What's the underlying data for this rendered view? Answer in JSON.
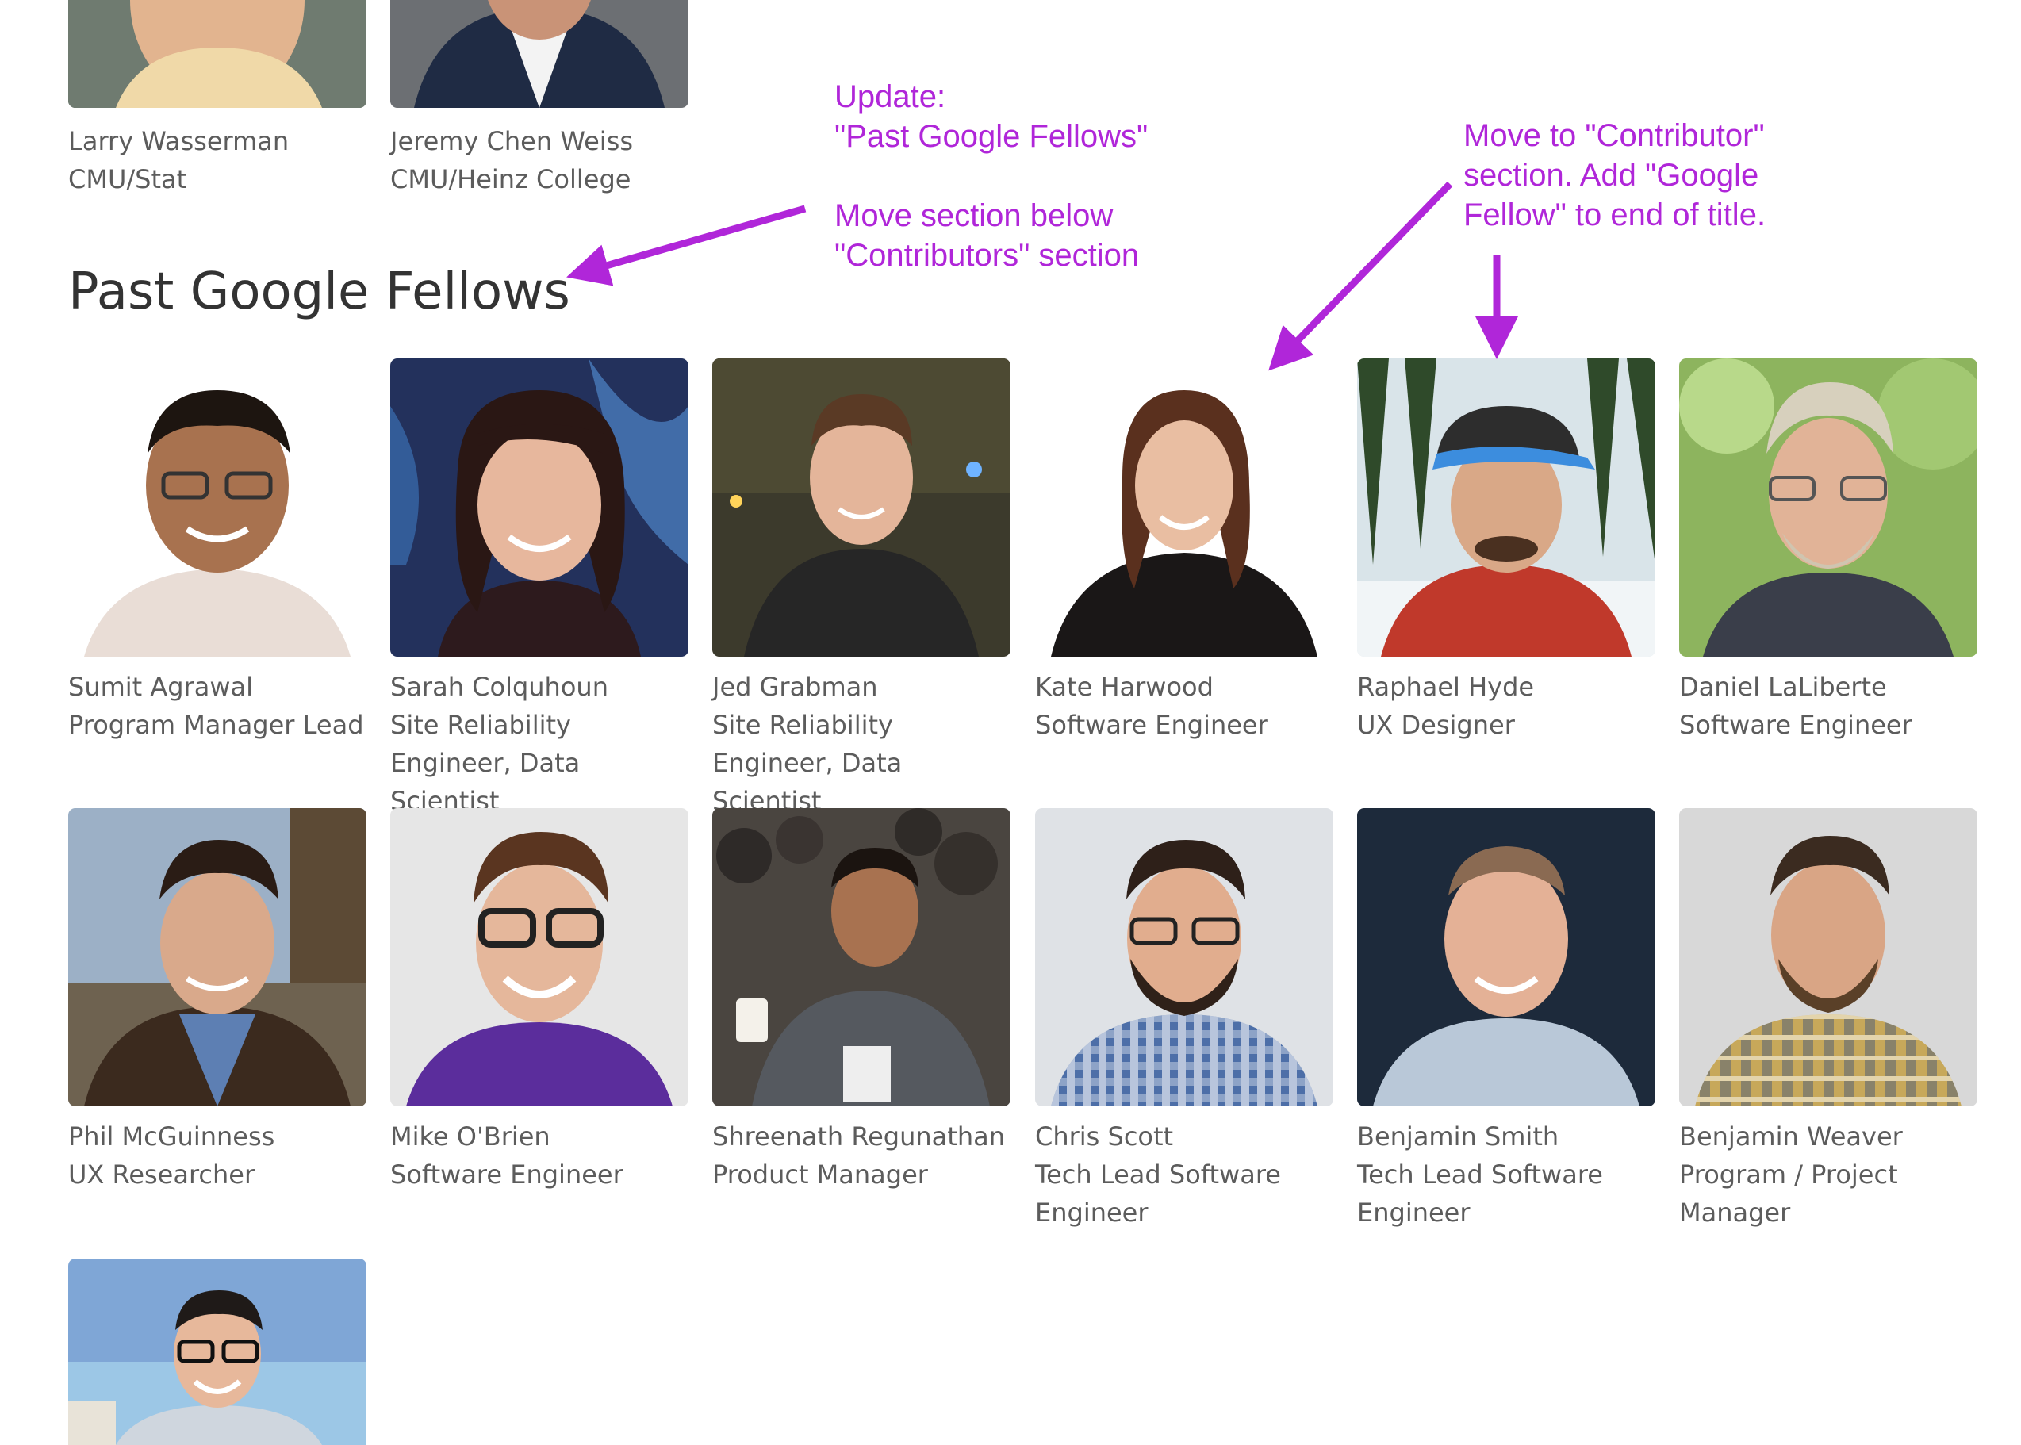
{
  "top_row": [
    {
      "name": "Larry Wasserman",
      "affiliation": "CMU/Stat"
    },
    {
      "name": "Jeremy Chen Weiss",
      "affiliation": "CMU/Heinz College"
    }
  ],
  "section": {
    "title": "Past Google Fellows"
  },
  "fellows": [
    {
      "name": "Sumit Agrawal",
      "role": "Program Manager Lead"
    },
    {
      "name": "Sarah Colquhoun",
      "role": "Site Reliability Engineer, Data Scientist"
    },
    {
      "name": "Jed Grabman",
      "role": "Site Reliability Engineer, Data Scientist"
    },
    {
      "name": "Kate Harwood",
      "role": "Software Engineer"
    },
    {
      "name": "Raphael Hyde",
      "role": "UX Designer"
    },
    {
      "name": "Daniel LaLiberte",
      "role": "Software Engineer"
    },
    {
      "name": "Phil McGuinness",
      "role": "UX Researcher"
    },
    {
      "name": "Mike O'Brien",
      "role": "Software Engineer"
    },
    {
      "name": "Shreenath Regunathan",
      "role": "Product Manager"
    },
    {
      "name": "Chris Scott",
      "role": "Tech Lead Software Engineer"
    },
    {
      "name": "Benjamin Smith",
      "role": "Tech Lead Software Engineer"
    },
    {
      "name": "Benjamin Weaver",
      "role": "Program / Project Manager"
    }
  ],
  "annotations": {
    "note1": {
      "lines": [
        "Update:",
        "\"Past Google Fellows\"",
        "",
        "Move section below",
        "\"Contributors\" section"
      ]
    },
    "note2": {
      "lines": [
        "Move to \"Contributor\"",
        "section. Add \"Google",
        "Fellow\" to end of title."
      ]
    },
    "color": "#b026d9"
  },
  "colors": {
    "caption_text": "#5c5c5c",
    "title_text": "#333333",
    "annotation": "#b026d9"
  }
}
